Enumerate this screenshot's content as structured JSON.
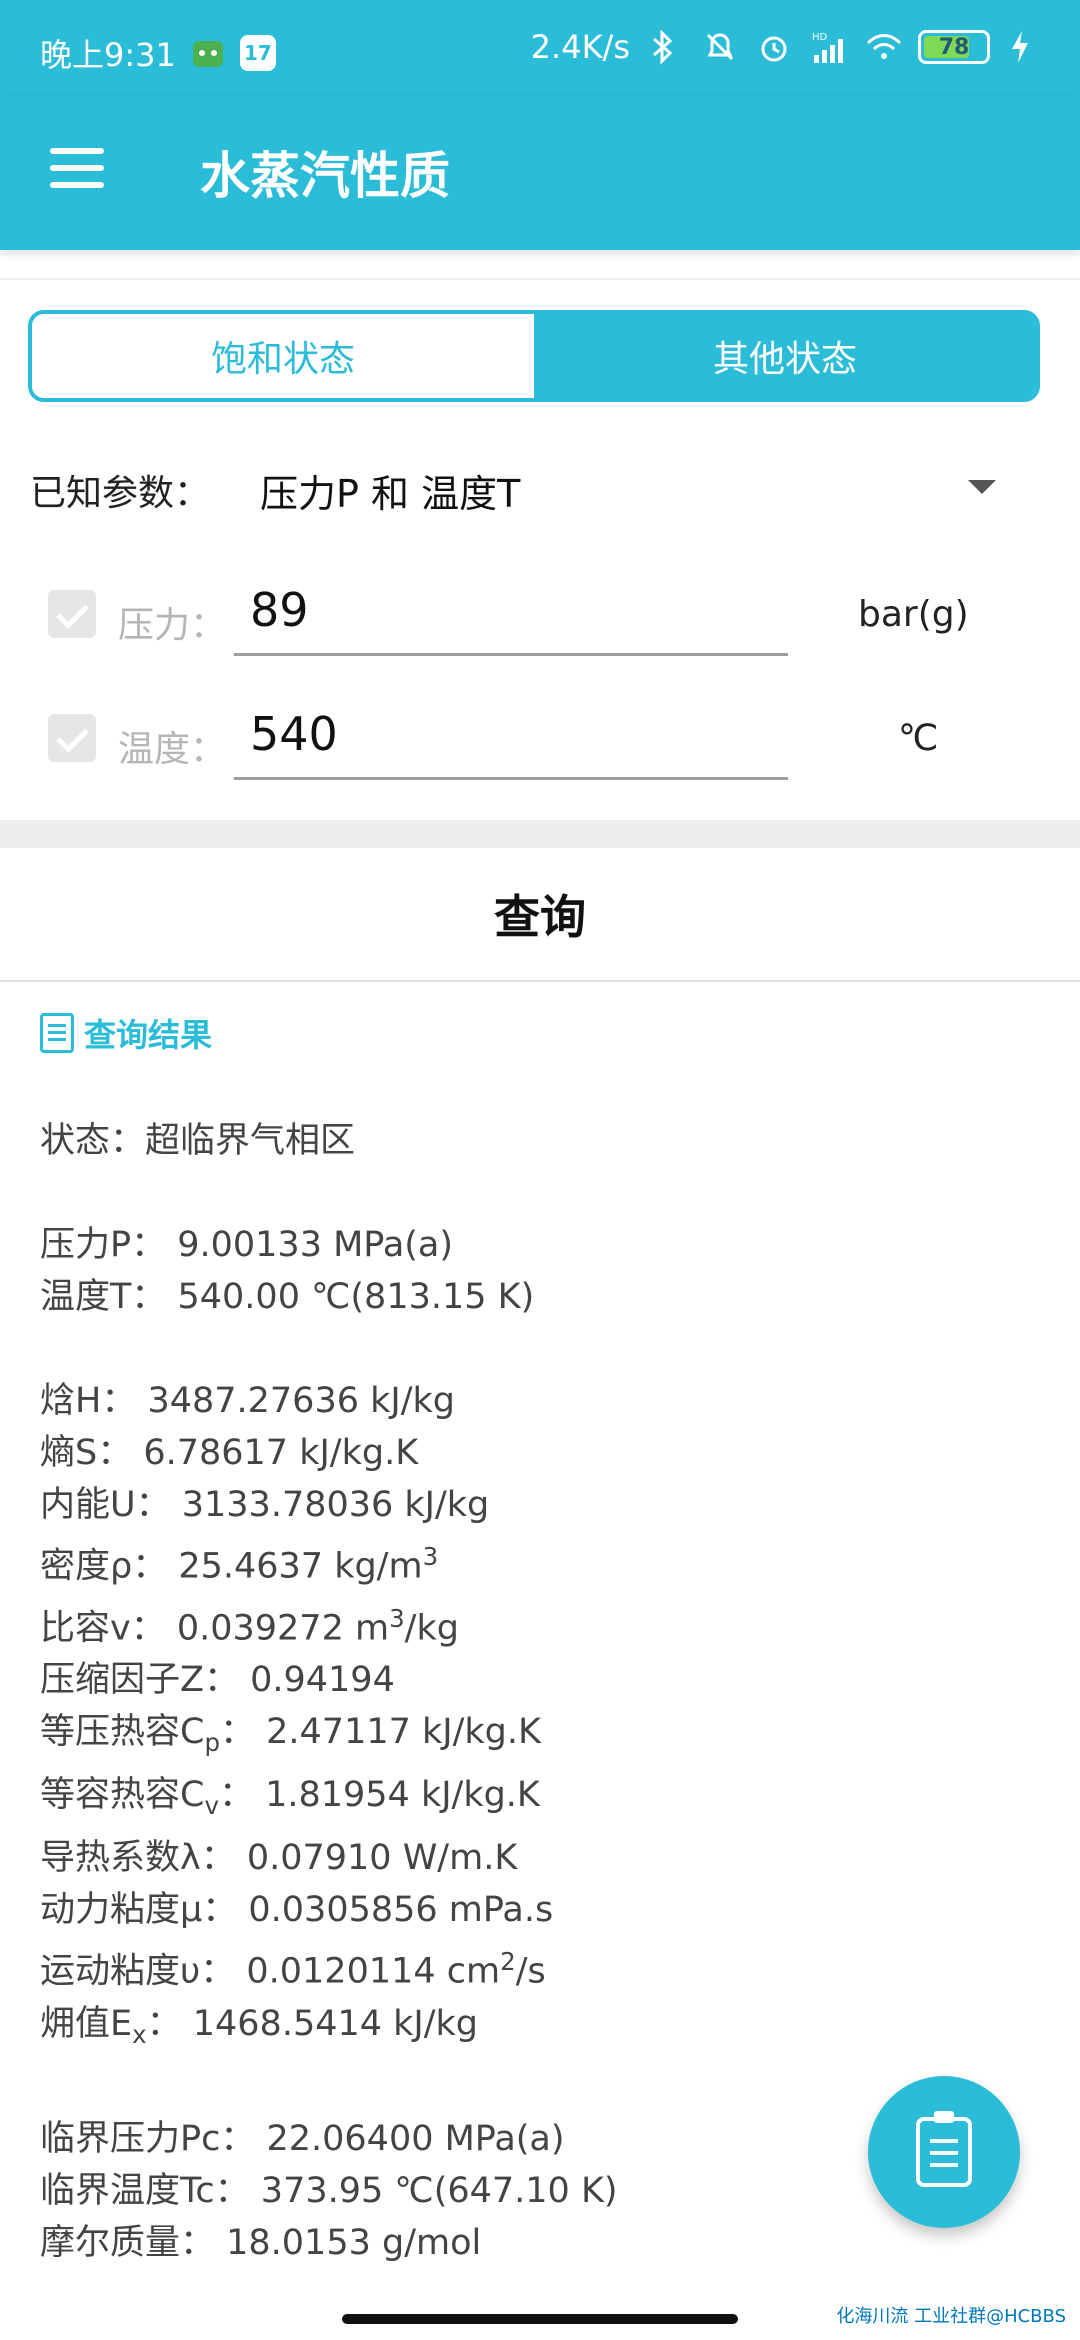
{
  "status": {
    "time": "晚上9:31",
    "net_speed": "2.4K/s",
    "battery": "78",
    "battery_level": 0.78,
    "hd": "HD",
    "calendar_day": "17"
  },
  "appbar": {
    "title": "水蒸汽性质"
  },
  "tabs": [
    {
      "label": "饱和状态",
      "active": false
    },
    {
      "label": "其他状态",
      "active": true
    }
  ],
  "known": {
    "label": "已知参数：",
    "value": "压力P 和 温度T"
  },
  "fields": {
    "pressure": {
      "label": "压力：",
      "value": "89",
      "unit": "bar(g)"
    },
    "temperature": {
      "label": "温度：",
      "value": "540",
      "unit": "℃"
    }
  },
  "query_button": "查询",
  "results_title": "查询结果",
  "results": {
    "state": "状态：超临界气相区",
    "pressure": "压力P：  9.00133 MPa(a)",
    "temperature": "温度T：  540.00 ℃(813.15 K)",
    "enthalpy": "焓H：  3487.27636 kJ/kg",
    "entropy": "熵S：  6.78617 kJ/kg.K",
    "internal_energy": "内能U：  3133.78036 kJ/kg",
    "density_prefix": "密度ρ：  25.4637 kg/m",
    "density_sup": "3",
    "spec_vol_prefix": "比容v：  0.039272 m",
    "spec_vol_sup": "3",
    "spec_vol_suffix": "/kg",
    "z_factor": "压缩因子Z：  0.94194",
    "cp_prefix": "等压热容C",
    "cp_sub": "p",
    "cp_suffix": "：  2.47117 kJ/kg.K",
    "cv_prefix": "等容热容C",
    "cv_sub": "v",
    "cv_suffix": "：  1.81954 kJ/kg.K",
    "conductivity": "导热系数λ：  0.07910 W/m.K",
    "dyn_visc": "动力粘度μ：  0.0305856 mPa.s",
    "kin_visc_prefix": "运动粘度υ：  0.0120114 cm",
    "kin_visc_sup": "2",
    "kin_visc_suffix": "/s",
    "exergy_prefix": "㶲值E",
    "exergy_sub": "x",
    "exergy_suffix": "：  1468.5414 kJ/kg",
    "critical_pressure": "临界压力Pc：  22.06400 MPa(a)",
    "critical_temperature": "临界温度Tc：  373.95 ℃(647.10 K)",
    "molar_mass": "摩尔质量：  18.0153 g/mol"
  },
  "watermark": "化海川流 工业社群@HCBBS",
  "colors": {
    "primary": "#2bbcd8",
    "battery": "#7ed957"
  }
}
